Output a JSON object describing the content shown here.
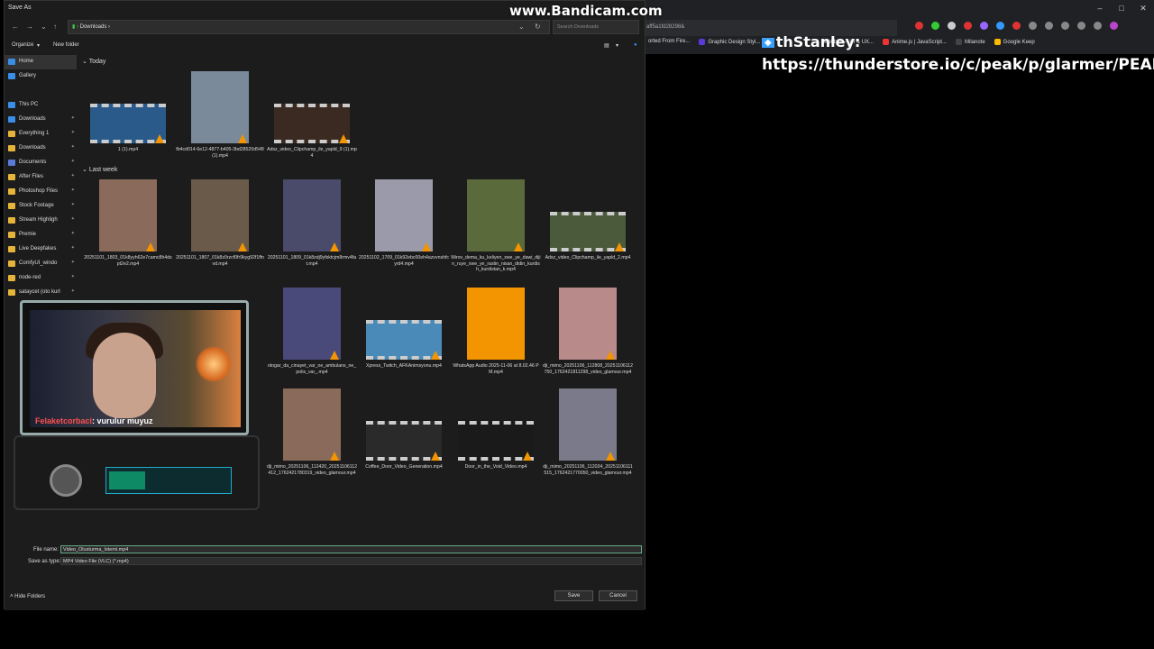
{
  "watermark": "www.Bandicam.com",
  "browser": {
    "url_fragment": "aff5a1fd28298&",
    "window_controls": [
      "–",
      "□",
      "✕"
    ],
    "bookmarks": [
      "orted From Fire...",
      "Graphic Design Styl...",
      "Mobbin — UI & UX...",
      "Anime.js | JavaScript...",
      "Milanote",
      "Google Keep"
    ],
    "overlay_chat_user": "thStanley:",
    "overlay_url": "https://thunderstore.io/c/peak/p/glarmer/PEAK_U"
  },
  "dialog": {
    "title": "Save As",
    "breadcrumb": "Downloads",
    "search_placeholder": "Search Downloads",
    "toolbar": {
      "organize": "Organize",
      "new_folder": "New folder"
    },
    "sidebar": [
      {
        "label": "Home",
        "selected": true,
        "color": "#3a8ee6"
      },
      {
        "label": "Gallery",
        "color": "#3a8ee6"
      },
      {
        "label": "This PC",
        "color": "#3a8ee6"
      },
      {
        "label": "Downloads",
        "color": "#3a8ee6"
      },
      {
        "label": "Everything 1",
        "color": "#e6b43a"
      },
      {
        "label": "Downloads",
        "color": "#e6b43a"
      },
      {
        "label": "Documents",
        "color": "#5a7ad8"
      },
      {
        "label": "After Files",
        "color": "#e6b43a"
      },
      {
        "label": "Photoshop Files",
        "color": "#e6b43a"
      },
      {
        "label": "Stock Footage",
        "color": "#e6b43a"
      },
      {
        "label": "Stream Highligh",
        "color": "#e6b43a"
      },
      {
        "label": "Premie",
        "color": "#e6b43a"
      },
      {
        "label": "Live Deepfakes",
        "color": "#e6b43a"
      },
      {
        "label": "ComfyUI_windo",
        "color": "#e6b43a"
      },
      {
        "label": "node-red",
        "color": "#e6b43a"
      },
      {
        "label": "sataycet (oto kurl",
        "color": "#e6b43a"
      }
    ],
    "groups": {
      "today": "Today",
      "last_week": "Last week"
    },
    "files_today": [
      {
        "name": "1 (1).mp4",
        "film": true,
        "color": "#2a5a8a"
      },
      {
        "name": "fb4cd014-6e12-4877-b405-3bd28520d548 (1).mp4",
        "film": false,
        "color": "#7a8a9a"
      },
      {
        "name": "Adsz_video_Clipchamp_ile_yapld_9 (1).mp4",
        "film": true,
        "color": "#3a2a22"
      }
    ],
    "files_last_week": [
      {
        "name": "20251101_1803_01k8yyh62e7camc8h4dspt2e2.mp4",
        "film": false,
        "color": "#8a6a5a"
      },
      {
        "name": "20251101_1807_01k8z0rzcf0fr9kyg92f1ffnvd.mp4",
        "film": false,
        "color": "#6a5a4a"
      },
      {
        "name": "20251101_1809_01k8zdj9yfsktcjm8rmv4fat.mp4",
        "film": false,
        "color": "#4a4a6a"
      },
      {
        "name": "20251102_1709_01k92ebc00eh4azvvnshfcyrd4.mp4",
        "film": false,
        "color": "#9a9aaa"
      },
      {
        "name": "Mirov_dema_ku_keliyen_xwe_ye_dawi_dijin_ruye_xwe_ye_rastin_nisan_didin_kurdish_kurdistan_k.mp4",
        "film": false,
        "color": "#5a6a3a"
      },
      {
        "name": "Adsz_video_Clipchamp_ile_yapld_2.mp4",
        "film": true,
        "color": "#4a5a3a"
      },
      {
        "name": "otogar_da_cinayet_var_ne_ambulans_ne_polis_var_.mp4",
        "film": false,
        "color": "#4a4a7a"
      },
      {
        "name": "Xpress_Twitch_AFKAnimsyonu.mp4",
        "film": true,
        "color": "#4a8ab8"
      },
      {
        "name": "WhatsApp Audio 2025-11-06 at 8.02.46 PM.mp4",
        "film": false,
        "color": "#f29500"
      },
      {
        "name": "dji_mimo_20251106_112808_20251106112750_1762421811298_video_glamour.mp4",
        "film": false,
        "color": "#b88a8a"
      },
      {
        "name": "dji_mimo_20251106_112420_20251106112412_1762421780319_video_glamour.mp4",
        "film": false,
        "color": "#8a6a5a"
      },
      {
        "name": "Coffee_Door_Video_Generation.mp4",
        "film": true,
        "color": "#2a2a2a"
      },
      {
        "name": "Door_in_the_Void_Video.mp4",
        "film": true,
        "color": "#1a1a1a"
      },
      {
        "name": "dji_mimo_20251106_112034_20251106111515_1762421770050_video_glamour.mp4",
        "film": false,
        "color": "#7a7a8a"
      }
    ],
    "file_name_label": "File name:",
    "file_name_value": "Video_Olusturma_Istemi.mp4",
    "save_type_label": "Save as type:",
    "save_type_value": "MP4 Video File (VLC) (*.mp4)",
    "hide_folders": "Hide Folders",
    "save_button": "Save",
    "cancel_button": "Cancel"
  },
  "webcam": {
    "chat_user": "Felaketcorbaci",
    "chat_message": ": vurulur muyuz"
  }
}
